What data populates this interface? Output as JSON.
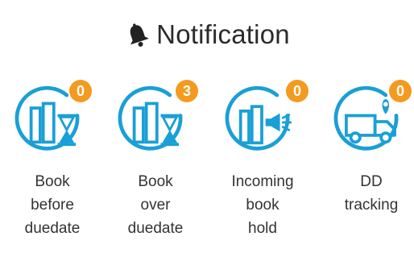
{
  "header": {
    "title": "Notification",
    "icon": "bell-icon"
  },
  "colors": {
    "icon_blue": "#1a9fd6",
    "badge_orange": "#f39a1f",
    "text": "#333333"
  },
  "tiles": [
    {
      "id": "book-before-duedate",
      "label_lines": [
        "Book",
        "before",
        "duedate"
      ],
      "count": "0",
      "icon": "books-hourglass-icon"
    },
    {
      "id": "book-over-duedate",
      "label_lines": [
        "Book",
        "over",
        "duedate"
      ],
      "count": "3",
      "icon": "books-hourglass-icon"
    },
    {
      "id": "incoming-book-hold",
      "label_lines": [
        "Incoming",
        "book",
        "hold"
      ],
      "count": "0",
      "icon": "books-megaphone-icon"
    },
    {
      "id": "dd-tracking",
      "label_lines": [
        "DD",
        "tracking"
      ],
      "count": "0",
      "icon": "truck-location-icon"
    }
  ]
}
